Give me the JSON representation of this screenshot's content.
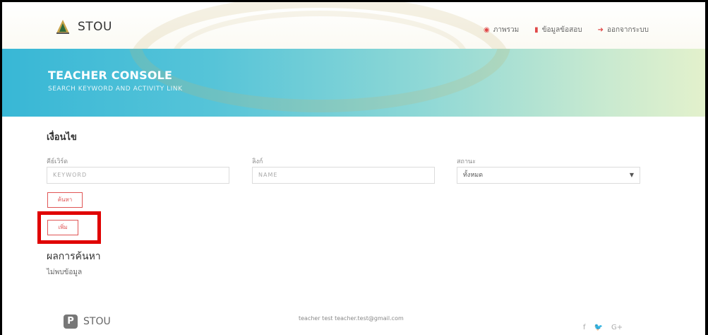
{
  "header": {
    "brand": "STOU",
    "nav": [
      {
        "label": "ภาพรวม",
        "icon": "dashboard-icon"
      },
      {
        "label": "ข้อมูลข้อสอบ",
        "icon": "book-icon"
      },
      {
        "label": "ออกจากระบบ",
        "icon": "logout-icon"
      }
    ]
  },
  "banner": {
    "title": "TEACHER CONSOLE",
    "subtitle": "SEARCH KEYWORD AND ACTIVITY LINK"
  },
  "filter": {
    "title": "เงื่อนไข",
    "keyword_label": "คีย์เวิร์ด",
    "keyword_placeholder": "KEYWORD",
    "link_label": "ลิงก์",
    "link_placeholder": "NAME",
    "status_label": "สถานะ",
    "status_value": "ทั้งหมด",
    "search_button": "ค้นหา",
    "add_button": "เพิ่ม"
  },
  "results": {
    "title": "ผลการค้นหา",
    "empty": "ไม่พบข้อมูล"
  },
  "footer": {
    "brand": "STOU",
    "logo_letter": "P",
    "contact": "teacher test teacher.test@gmail.com",
    "social": [
      "f",
      "🐦",
      "G+"
    ]
  },
  "colors": {
    "accent": "#e05555",
    "highlight": "#e00000",
    "banner_start": "#38b7d6",
    "banner_end": "#e3f1cc"
  }
}
